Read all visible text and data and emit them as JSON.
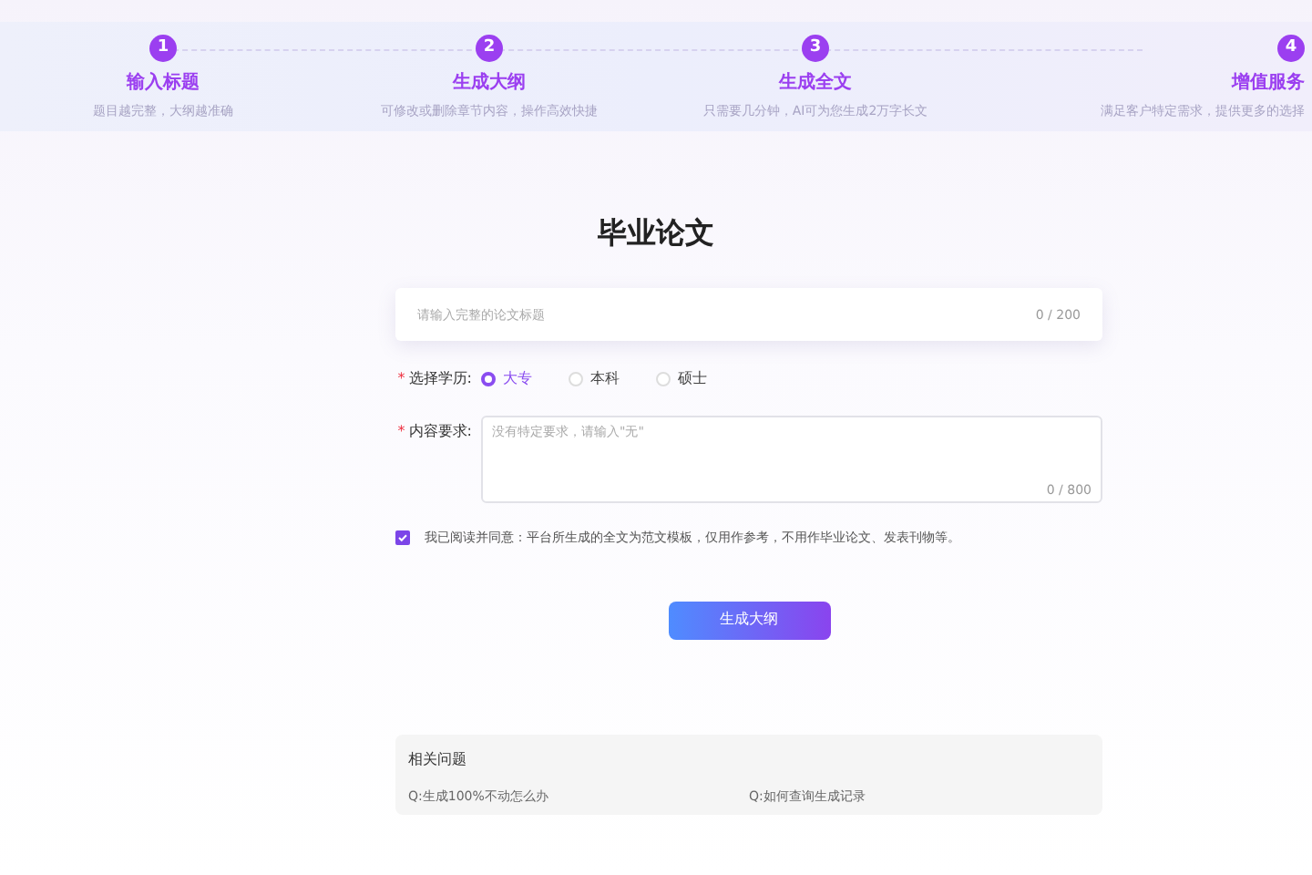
{
  "steps": [
    {
      "number": "1",
      "title": "输入标题",
      "desc": "题目越完整，大纲越准确"
    },
    {
      "number": "2",
      "title": "生成大纲",
      "desc": "可修改或删除章节内容，操作高效快捷"
    },
    {
      "number": "3",
      "title": "生成全文",
      "desc": "只需要几分钟，AI可为您生成2万字长文"
    },
    {
      "number": "4",
      "title": "增值服务",
      "desc": "满足客户特定需求，提供更多的选择"
    }
  ],
  "page_title": "毕业论文",
  "title_field": {
    "placeholder": "请输入完整的论文标题",
    "counter": "0 / 200"
  },
  "degree": {
    "label": "选择学历:",
    "required_mark": "*",
    "options": [
      {
        "label": "大专",
        "selected": true
      },
      {
        "label": "本科",
        "selected": false
      },
      {
        "label": "硕士",
        "selected": false
      }
    ]
  },
  "requirements": {
    "label": "内容要求:",
    "required_mark": "*",
    "placeholder": "没有特定要求，请输入\"无\"",
    "counter": "0 / 800"
  },
  "agreement": {
    "checked": true,
    "text": "我已阅读并同意：平台所生成的全文为范文模板，仅用作参考，不用作毕业论文、发表刊物等。"
  },
  "submit_button": "生成大纲",
  "related": {
    "title": "相关问题",
    "questions": [
      "Q:生成100%不动怎么办",
      "Q:如何查询生成记录"
    ]
  }
}
